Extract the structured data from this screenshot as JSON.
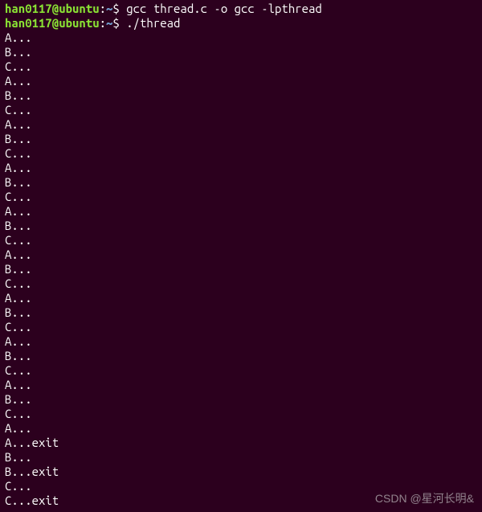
{
  "prompt": {
    "user_host": "han0117@ubuntu",
    "colon": ":",
    "path": "~",
    "dollar": "$"
  },
  "commands": {
    "cmd1": "gcc thread.c -o gcc -lpthread",
    "cmd2": "./thread"
  },
  "output_lines": {
    "l0": "A...",
    "l1": "B...",
    "l2": "C...",
    "l3": "A...",
    "l4": "B...",
    "l5": "C...",
    "l6": "A...",
    "l7": "B...",
    "l8": "C...",
    "l9": "A...",
    "l10": "B...",
    "l11": "C...",
    "l12": "A...",
    "l13": "B...",
    "l14": "C...",
    "l15": "A...",
    "l16": "B...",
    "l17": "C...",
    "l18": "A...",
    "l19": "B...",
    "l20": "C...",
    "l21": "A...",
    "l22": "B...",
    "l23": "C...",
    "l24": "A...",
    "l25": "B...",
    "l26": "C...",
    "l27": "A...",
    "l28": "A...exit",
    "l29": "B...",
    "l30": "B...exit",
    "l31": "C...",
    "l32": "C...exit"
  },
  "watermark": "CSDN @星河长明&"
}
